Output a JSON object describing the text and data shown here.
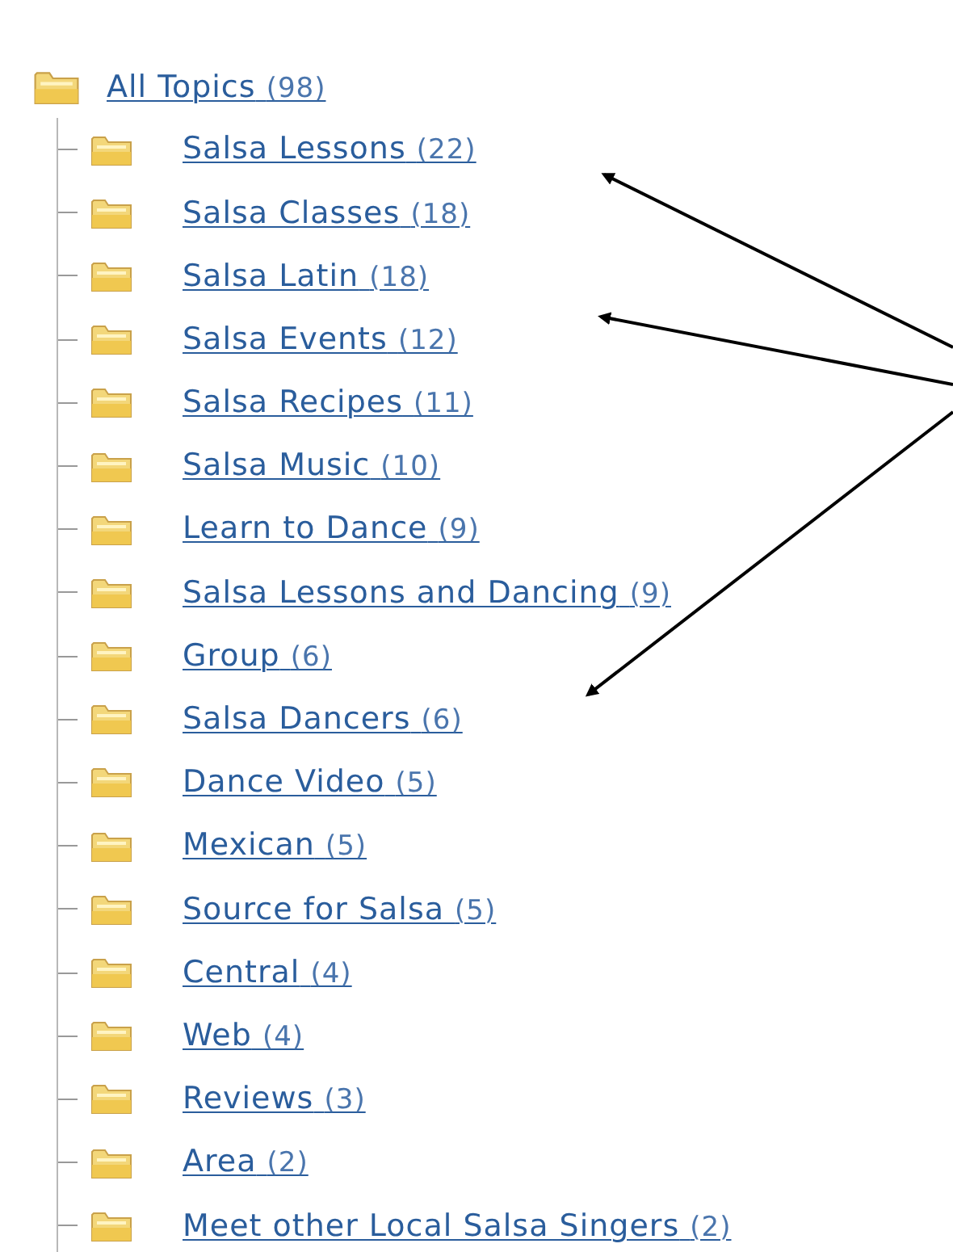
{
  "root": {
    "name": "All Topics",
    "count": "(98)",
    "children": [
      {
        "name": "Salsa Lessons",
        "count": "(22)"
      },
      {
        "name": "Salsa Classes",
        "count": "(18)"
      },
      {
        "name": "Salsa Latin",
        "count": "(18)"
      },
      {
        "name": "Salsa Events",
        "count": "(12)"
      },
      {
        "name": "Salsa Recipes",
        "count": "(11)"
      },
      {
        "name": "Salsa Music",
        "count": "(10)"
      },
      {
        "name": "Learn to Dance",
        "count": "(9)"
      },
      {
        "name": "Salsa Lessons and Dancing",
        "count": "(9)"
      },
      {
        "name": "Group",
        "count": "(6)"
      },
      {
        "name": "Salsa Dancers",
        "count": "(6)"
      },
      {
        "name": "Dance Video",
        "count": "(5)"
      },
      {
        "name": "Mexican",
        "count": "(5)"
      },
      {
        "name": "Source for Salsa",
        "count": "(5)"
      },
      {
        "name": "Central",
        "count": "(4)"
      },
      {
        "name": "Web",
        "count": "(4)"
      },
      {
        "name": "Reviews",
        "count": "(3)"
      },
      {
        "name": "Area",
        "count": "(2)"
      },
      {
        "name": "Meet other Local Salsa Singers",
        "count": "(2)"
      }
    ]
  }
}
